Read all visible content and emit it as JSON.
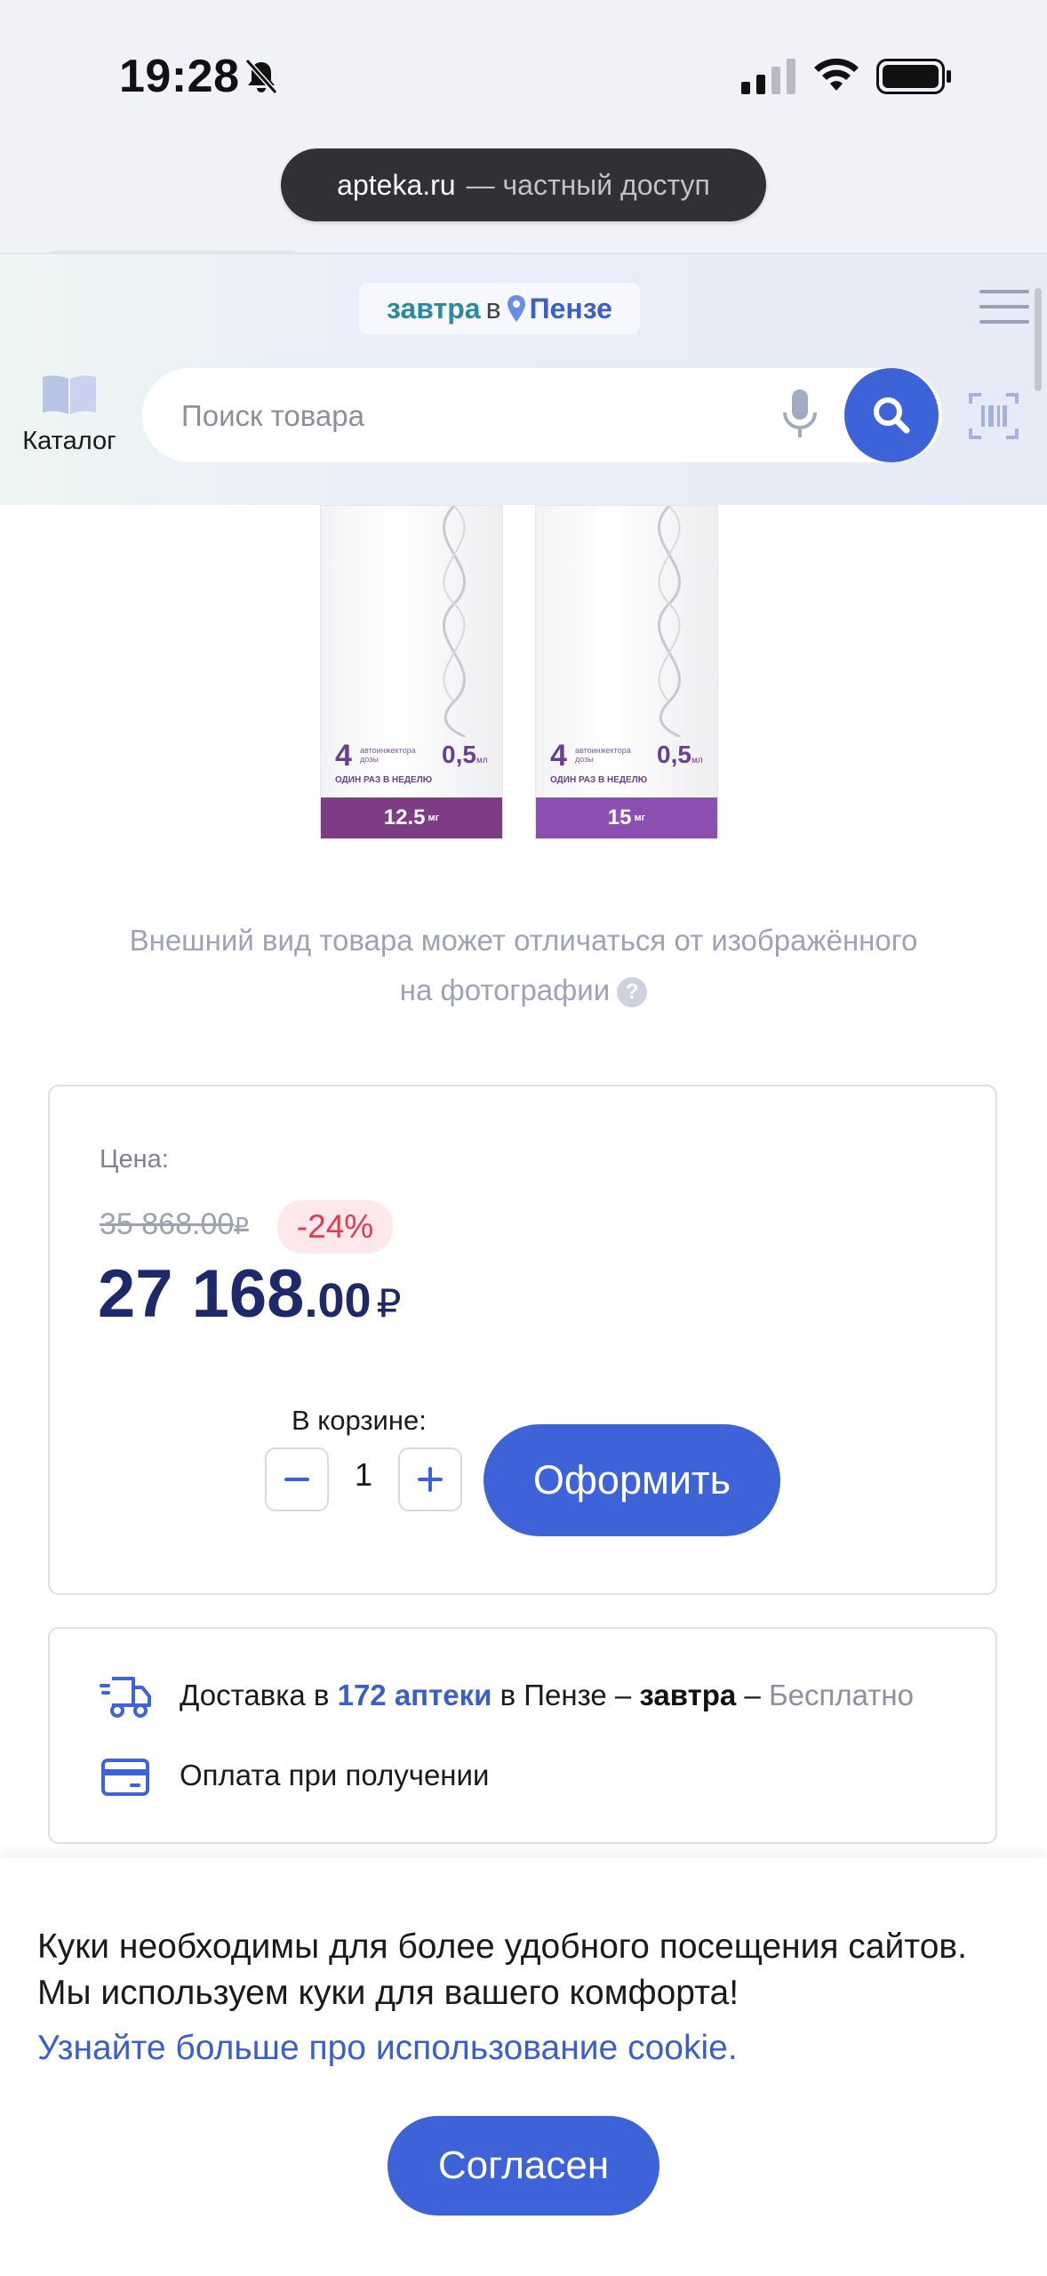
{
  "status_bar": {
    "time": "19:28",
    "icons": [
      "bell-off-icon",
      "cellular-signal-icon",
      "wifi-icon",
      "battery-icon"
    ]
  },
  "browser": {
    "domain": "apteka.ru",
    "private_label": "— частный доступ"
  },
  "header": {
    "delivery_when": "завтра",
    "delivery_prep": "в",
    "delivery_city": "Пензе",
    "catalog_label": "Каталог",
    "search_placeholder": "Поиск товара"
  },
  "product": {
    "packages": [
      {
        "count": "4",
        "dose": "0,5",
        "strength": "12.5",
        "band_color": "#7e3c85"
      },
      {
        "count": "4",
        "dose": "0,5",
        "strength": "15",
        "band_color": "#8a4fb0"
      }
    ],
    "package_text": "автоинжектора дозы",
    "package_unit_ml": "мл",
    "package_unit_mg": "мг",
    "package_week": "ОДИН РАЗ В НЕДЕЛЮ",
    "disclaimer_line1": "Внешний вид товара может отличаться от изображённого",
    "disclaimer_line2": "на фотографии"
  },
  "price": {
    "label": "Цена:",
    "old_price": "35 868.00",
    "currency": "₽",
    "discount": "-24%",
    "new_price_main": "27 168",
    "new_price_cents": ".00",
    "cart_label": "В корзине:",
    "quantity": "1",
    "checkout_label": "Оформить"
  },
  "delivery": {
    "prefix": "Доставка в ",
    "pharmacies": "172 аптеки",
    "in_city": " в Пензе – ",
    "when": "завтра",
    "dash": " – ",
    "cost": "Бесплатно",
    "payment": "Оплата при получении"
  },
  "cookie": {
    "text": "Куки необходимы для более удобного посещения сайтов. Мы используем куки для вашего комфорта!",
    "link": "Узнайте больше про использование cookie.",
    "button": "Согласен"
  },
  "colors": {
    "accent": "#3e63d8",
    "price": "#1c2a6b",
    "discount": "#e23a4f"
  }
}
